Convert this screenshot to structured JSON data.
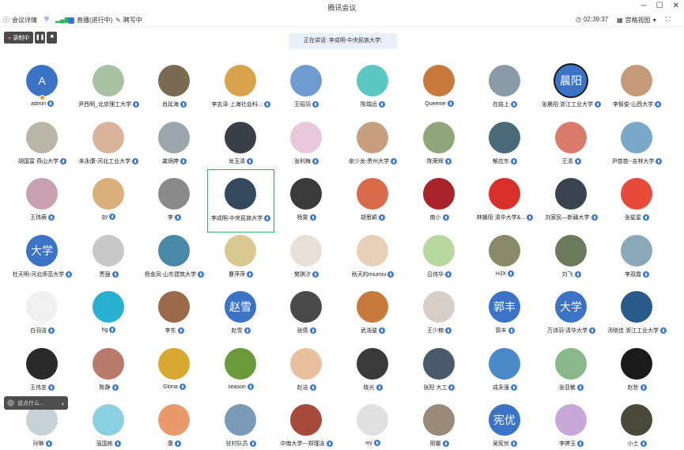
{
  "window": {
    "title": "腾讯会议",
    "minimize": "─",
    "maximize": "☐",
    "close": "✕"
  },
  "toolbar": {
    "info": "会议详情",
    "live": "直播(进行中)",
    "draw": "聘写中",
    "timer": "02:39:37",
    "view": "宫格视图"
  },
  "recording": {
    "label": "录制中",
    "pause": "❚❚",
    "stop": "■"
  },
  "speaking": "正在讲话: 李成明-中央民族大学;",
  "chat": {
    "placeholder": "说点什么..."
  },
  "participants": [
    [
      {
        "name": "admin",
        "avatar_text": "A",
        "avatar_color": "#3b73c6"
      },
      {
        "name": "尹西明_北京理工大学",
        "avatar_color": "#a9c2a4"
      },
      {
        "name": "肖延海",
        "avatar_color": "#7a6a52"
      },
      {
        "name": "李志泽-上海社会科...",
        "avatar_color": "#d9a34c"
      },
      {
        "name": "王昭羽",
        "avatar_color": "#6f9bd1"
      },
      {
        "name": "陈瑞远",
        "avatar_color": "#5bc7c2"
      },
      {
        "name": "Queenie",
        "avatar_color": "#c87a3c"
      },
      {
        "name": "在路上",
        "avatar_color": "#8a9aa8"
      },
      {
        "name": "张晨阳 浙江工业大学",
        "avatar_text": "晨阳",
        "avatar_color": "#3b73c6"
      },
      {
        "name": "李智俊-山西大学",
        "avatar_color": "#c59a7a"
      }
    ],
    [
      {
        "name": "胡国富 燕山大学",
        "avatar_color": "#b9b6a8"
      },
      {
        "name": "朱永康-河北工业大学",
        "avatar_color": "#d9b49a"
      },
      {
        "name": "龚炳婷",
        "avatar_color": "#9aa6ac"
      },
      {
        "name": "龙玉清",
        "avatar_color": "#3b4048"
      },
      {
        "name": "张利梅",
        "avatar_color": "#e9c8dc"
      },
      {
        "name": "余少龙-贵州大学",
        "avatar_color": "#c8a080"
      },
      {
        "name": "陈荣辉",
        "avatar_color": "#8fa67a"
      },
      {
        "name": "郁应东",
        "avatar_color": "#4a6a7a"
      },
      {
        "name": "王清",
        "avatar_color": "#d97a6a"
      },
      {
        "name": "尹苗苗--吉林大学",
        "avatar_color": "#7aa8c8"
      }
    ],
    [
      {
        "name": "王玮萌",
        "avatar_color": "#c9a0b0"
      },
      {
        "name": "gy",
        "avatar_color": "#d9b07a"
      },
      {
        "name": "李",
        "avatar_color": "#8a8a8a"
      },
      {
        "name": "李成明-中央民族大学",
        "avatar_color": "#34495e",
        "active": true
      },
      {
        "name": "杨雯",
        "avatar_color": "#3a3a3a"
      },
      {
        "name": "胡思颖",
        "avatar_color": "#d96a4a"
      },
      {
        "name": "南小",
        "avatar_color": "#a8242a"
      },
      {
        "name": "林姗阳 清华大学&...",
        "avatar_color": "#d9302a"
      },
      {
        "name": "刘家民—新疆大学",
        "avatar_color": "#3a4350"
      },
      {
        "name": "张星星",
        "avatar_color": "#e84a3a"
      }
    ],
    [
      {
        "name": "杜天明-河北师范大学",
        "avatar_text": "大学",
        "avatar_color": "#3b73c6"
      },
      {
        "name": "贾强",
        "avatar_color": "#c8c8c8"
      },
      {
        "name": "杨金凤-山东建筑大学",
        "avatar_color": "#4a8aa8"
      },
      {
        "name": "曹萍萍",
        "avatar_color": "#d9c890"
      },
      {
        "name": "樊琪汐",
        "avatar_color": "#e8e0d8"
      },
      {
        "name": "秋天的miumiu",
        "avatar_color": "#e8d0b8"
      },
      {
        "name": "吕伟华",
        "avatar_color": "#b8d8a0"
      },
      {
        "name": "HJX",
        "avatar_color": "#8a8a6a"
      },
      {
        "name": "刘飞",
        "avatar_color": "#6a7a5a"
      },
      {
        "name": "李双霞",
        "avatar_color": "#8aa8b8"
      }
    ],
    [
      {
        "name": "白羽洁",
        "avatar_color": "#f0f0f0"
      },
      {
        "name": "hg",
        "avatar_color": "#2ab0d0"
      },
      {
        "name": "李东",
        "avatar_color": "#9a6a4a"
      },
      {
        "name": "赵雪",
        "avatar_text": "赵雪",
        "avatar_color": "#3b73c6"
      },
      {
        "name": "张倩",
        "avatar_color": "#4a4a4a"
      },
      {
        "name": "武浩骏",
        "avatar_color": "#c87a3a"
      },
      {
        "name": "王少楠",
        "avatar_color": "#d8d0c8"
      },
      {
        "name": "郭丰",
        "avatar_text": "郭丰",
        "avatar_color": "#3b73c6"
      },
      {
        "name": "万诗羽-清华大学",
        "avatar_text": "大学",
        "avatar_color": "#3b73c6"
      },
      {
        "name": "汤晓佳 浙江工业大学",
        "avatar_color": "#2a5a8a"
      }
    ],
    [
      {
        "name": "王伟忠",
        "avatar_color": "#2a2a2a"
      },
      {
        "name": "陈静",
        "avatar_color": "#b87a6a"
      },
      {
        "name": "Gloria",
        "avatar_color": "#d8a830"
      },
      {
        "name": "season",
        "avatar_color": "#6a9a3a"
      },
      {
        "name": "赵洁",
        "avatar_color": "#e8c0a0"
      },
      {
        "name": "晓光",
        "avatar_color": "#3a3a3a"
      },
      {
        "name": "张阳 大工",
        "avatar_color": "#4a5a6a"
      },
      {
        "name": "成永强",
        "avatar_color": "#4a8ac8"
      },
      {
        "name": "张亚敏",
        "avatar_color": "#8ab88a"
      },
      {
        "name": "赵哲",
        "avatar_color": "#1a1a1a"
      }
    ],
    [
      {
        "name": "孙琳",
        "avatar_color": "#c8d0d8"
      },
      {
        "name": "寇国栋",
        "avatar_color": "#8ad0e0"
      },
      {
        "name": "康",
        "avatar_color": "#e89a6a"
      },
      {
        "name": "驻村队员",
        "avatar_color": "#7a9ab8"
      },
      {
        "name": "中南大学---郑瑾洁",
        "avatar_color": "#a84a3a"
      },
      {
        "name": "ivy",
        "avatar_color": "#e0e0e0"
      },
      {
        "name": "邢娜",
        "avatar_color": "#9a8a7a"
      },
      {
        "name": "吴宪优",
        "avatar_text": "宪优",
        "avatar_color": "#3b73c6"
      },
      {
        "name": "李婷玉",
        "avatar_color": "#c8a8d8"
      },
      {
        "name": "小土",
        "avatar_color": "#4a4a3a"
      }
    ]
  ]
}
